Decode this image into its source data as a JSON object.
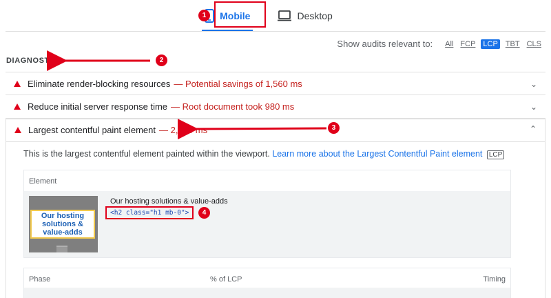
{
  "tabs": {
    "mobile_label": "Mobile",
    "desktop_label": "Desktop"
  },
  "filter": {
    "label": "Show audits relevant to:",
    "options": [
      "All",
      "FCP",
      "LCP",
      "TBT",
      "CLS"
    ],
    "active": "LCP"
  },
  "diagnostics": {
    "title": "DIAGNOSTICS"
  },
  "audits": [
    {
      "title": "Eliminate render-blocking resources",
      "detail": "— Potential savings of 1,560 ms"
    },
    {
      "title": "Reduce initial server response time",
      "detail": "— Root document took 980 ms"
    },
    {
      "title": "Largest contentful paint element",
      "detail": "— 2,560 ms"
    }
  ],
  "expanded": {
    "description": "This is the largest contentful element painted within the viewport.",
    "learn_more": "Learn more about the Largest Contentful Paint element",
    "chip": "LCP",
    "element_header": "Element",
    "element_text": "Our hosting solutions & value-adds",
    "element_code": "<h2 class=\"h1 mb-0\">",
    "thumb_text": "Our hosting solutions & value-adds",
    "phase_header": "Phase",
    "percent_header": "% of LCP",
    "timing_header": "Timing"
  },
  "annotations": [
    "1",
    "2",
    "3",
    "4"
  ],
  "colors": {
    "accent": "#1a73e8",
    "annotation_red": "#e0001a",
    "fail_red": "#c5221f"
  }
}
